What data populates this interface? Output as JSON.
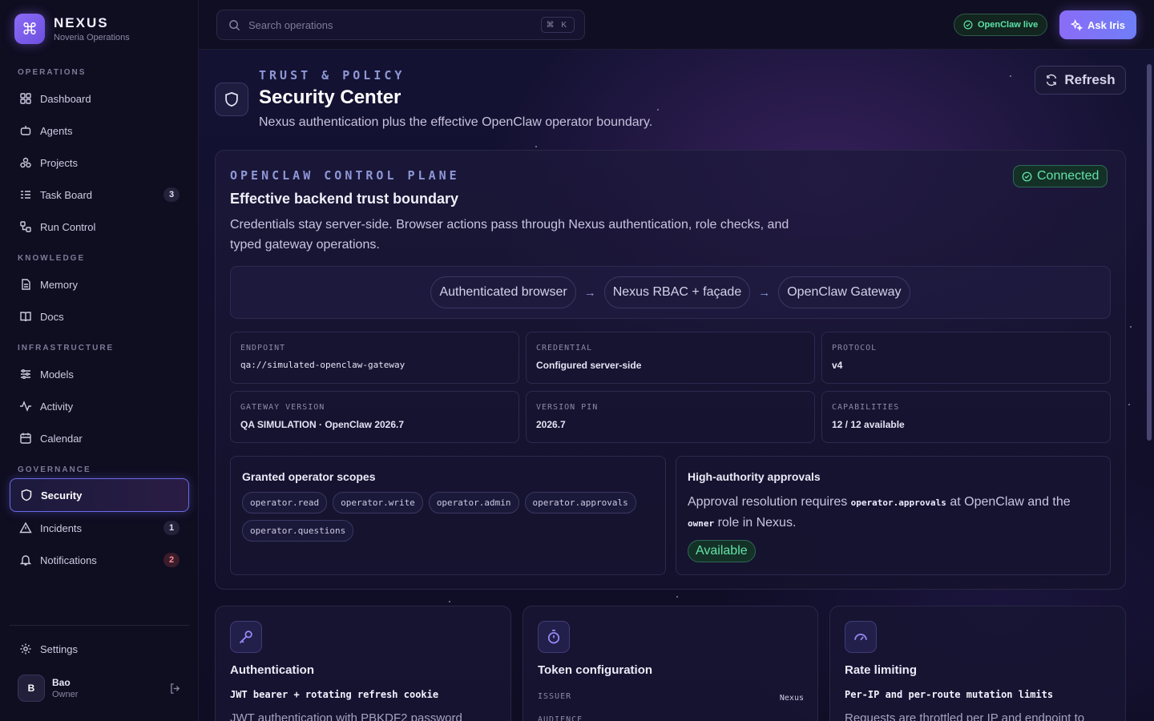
{
  "brand": {
    "name": "NEXUS",
    "subtitle": "Noveria Operations"
  },
  "sidebar": {
    "sections": [
      {
        "title": "OPERATIONS",
        "items": [
          {
            "label": "Dashboard",
            "icon": "grid-icon"
          },
          {
            "label": "Agents",
            "icon": "bot-icon"
          },
          {
            "label": "Projects",
            "icon": "boxes-icon"
          },
          {
            "label": "Task Board",
            "icon": "list-icon",
            "badge": "3"
          },
          {
            "label": "Run Control",
            "icon": "workflow-icon"
          }
        ]
      },
      {
        "title": "KNOWLEDGE",
        "items": [
          {
            "label": "Memory",
            "icon": "file-icon"
          },
          {
            "label": "Docs",
            "icon": "book-icon"
          }
        ]
      },
      {
        "title": "INFRASTRUCTURE",
        "items": [
          {
            "label": "Models",
            "icon": "sliders-icon"
          },
          {
            "label": "Activity",
            "icon": "activity-icon"
          },
          {
            "label": "Calendar",
            "icon": "calendar-icon"
          }
        ]
      },
      {
        "title": "GOVERNANCE",
        "items": [
          {
            "label": "Security",
            "icon": "shield-icon",
            "active": true
          },
          {
            "label": "Incidents",
            "icon": "alert-icon",
            "badge": "1"
          },
          {
            "label": "Notifications",
            "icon": "bell-icon",
            "badge": "2"
          }
        ]
      }
    ],
    "settings_label": "Settings",
    "user": {
      "initial": "B",
      "name": "Bao",
      "role": "Owner"
    }
  },
  "topbar": {
    "search_placeholder": "Search operations",
    "shortcut": "⌘ K",
    "live_label": "OpenClaw live",
    "ask_label": "Ask Iris"
  },
  "header": {
    "eyebrow": "TRUST & POLICY",
    "title": "Security Center",
    "subtitle": "Nexus authentication plus the effective OpenClaw operator boundary.",
    "refresh_label": "Refresh"
  },
  "control_plane": {
    "eyebrow": "OPENCLAW CONTROL PLANE",
    "title": "Effective backend trust boundary",
    "description": "Credentials stay server-side. Browser actions pass through Nexus authentication, role checks, and typed gateway operations.",
    "status": "Connected",
    "flow": [
      "Authenticated browser",
      "Nexus RBAC + façade",
      "OpenClaw Gateway"
    ],
    "flow_arrow": "→",
    "stats": [
      {
        "label": "ENDPOINT",
        "value": "qa://simulated-openclaw-gateway",
        "mono": true
      },
      {
        "label": "CREDENTIAL",
        "value": "Configured server-side"
      },
      {
        "label": "PROTOCOL",
        "value": "v4"
      },
      {
        "label": "GATEWAY VERSION",
        "value": "QA SIMULATION · OpenClaw 2026.7"
      },
      {
        "label": "VERSION PIN",
        "value": "2026.7"
      },
      {
        "label": "CAPABILITIES",
        "value": "12 / 12 available"
      }
    ],
    "scopes_title": "Granted operator scopes",
    "scopes": [
      "operator.read",
      "operator.write",
      "operator.admin",
      "operator.approvals",
      "operator.questions"
    ],
    "approvals_title": "High-authority approvals",
    "approvals_text_1": "Approval resolution requires ",
    "approvals_code_1": "operator.approvals",
    "approvals_text_2": " at OpenClaw and the ",
    "approvals_code_2": "owner",
    "approvals_text_3": " role in Nexus.",
    "approvals_status": "Available"
  },
  "features": [
    {
      "title": "Authentication",
      "subtitle": "JWT bearer + rotating refresh cookie",
      "description": "JWT authentication with PBKDF2 password",
      "icon": "key-icon"
    },
    {
      "title": "Token configuration",
      "kv": [
        {
          "key": "ISSUER",
          "value": "Nexus"
        },
        {
          "key": "AUDIENCE",
          "value": ""
        }
      ],
      "icon": "timer-icon"
    },
    {
      "title": "Rate limiting",
      "subtitle": "Per-IP and per-route mutation limits",
      "description": "Requests are throttled per IP and endpoint to",
      "icon": "gauge-icon"
    }
  ],
  "colors": {
    "accent": "#8b6cf6",
    "success": "#62e3a9",
    "danger": "#ff8a9a"
  }
}
